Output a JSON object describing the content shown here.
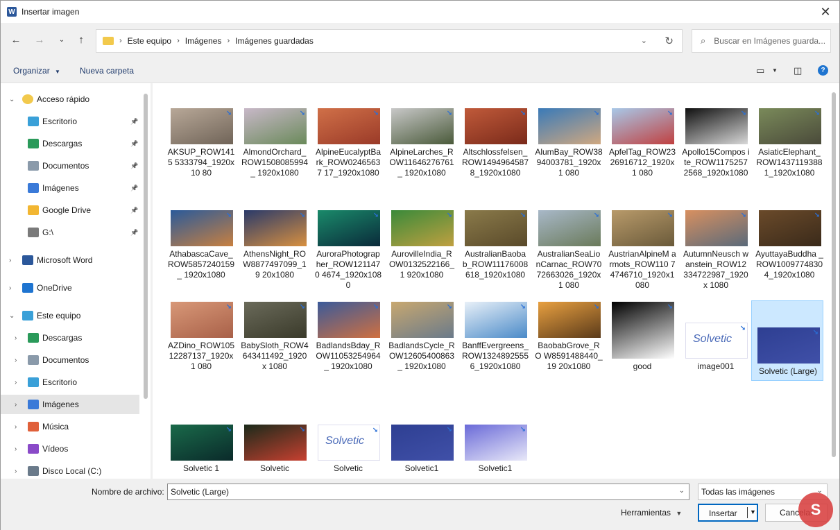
{
  "window": {
    "title": "Insertar imagen"
  },
  "nav": {
    "breadcrumb": [
      "Este equipo",
      "Imágenes",
      "Imágenes guardadas"
    ],
    "search_placeholder": "Buscar en Imágenes guarda..."
  },
  "commands": {
    "organize": "Organizar",
    "new_folder": "Nueva carpeta"
  },
  "sidebar": {
    "items": [
      {
        "label": "Acceso rápido",
        "icon": "star-icon",
        "level": 0,
        "expanded": true
      },
      {
        "label": "Escritorio",
        "icon": "desktop-icon",
        "level": 1,
        "pinned": true
      },
      {
        "label": "Descargas",
        "icon": "download-icon",
        "level": 1,
        "pinned": true
      },
      {
        "label": "Documentos",
        "icon": "document-icon",
        "level": 1,
        "pinned": true
      },
      {
        "label": "Imágenes",
        "icon": "pictures-icon",
        "level": 1,
        "pinned": true
      },
      {
        "label": "Google Drive",
        "icon": "google-drive-icon",
        "level": 1,
        "pinned": true
      },
      {
        "label": "G:\\",
        "icon": "drive-icon",
        "level": 1,
        "pinned": true
      },
      {
        "label": "Microsoft Word",
        "icon": "word-icon",
        "level": 0
      },
      {
        "label": "OneDrive",
        "icon": "cloud-icon",
        "level": 0
      },
      {
        "label": "Este equipo",
        "icon": "computer-icon",
        "level": 0,
        "expanded": true
      },
      {
        "label": "Descargas",
        "icon": "download-icon",
        "level": 1
      },
      {
        "label": "Documentos",
        "icon": "document-icon",
        "level": 1
      },
      {
        "label": "Escritorio",
        "icon": "desktop-icon",
        "level": 1
      },
      {
        "label": "Imágenes",
        "icon": "pictures-icon",
        "level": 1,
        "selected": true
      },
      {
        "label": "Música",
        "icon": "music-icon",
        "level": 1
      },
      {
        "label": "Vídeos",
        "icon": "video-icon",
        "level": 1
      },
      {
        "label": "Disco Local (C:)",
        "icon": "disk-icon",
        "level": 1
      }
    ]
  },
  "files": [
    {
      "name": "AKSUP_ROW1415 5333794_1920x10 80",
      "colors": [
        "#b8a898",
        "#706458"
      ]
    },
    {
      "name": "AlmondOrchard_ ROW1508085994_ 1920x1080",
      "colors": [
        "#c8b8c8",
        "#6a8a5a"
      ]
    },
    {
      "name": "AlpineEucalyptBa rk_ROW02465637 17_1920x1080",
      "colors": [
        "#d07048",
        "#9a3a28"
      ]
    },
    {
      "name": "AlpineLarches_R OW11646276761_ 1920x1080",
      "colors": [
        "#c8c8c8",
        "#4a5a3a"
      ]
    },
    {
      "name": "Altschlossfelsen_ ROW1494964587 8_1920x1080",
      "colors": [
        "#c05a3a",
        "#7a2a1a"
      ]
    },
    {
      "name": "AlumBay_ROW38 94003781_1920x1 080",
      "colors": [
        "#3a7ab8",
        "#d0a880"
      ]
    },
    {
      "name": "ApfelTag_ROW23 26916712_1920x1 080",
      "colors": [
        "#a8c8e8",
        "#c04040"
      ]
    },
    {
      "name": "Apollo15Compos ite_ROW1175257 2568_1920x1080",
      "colors": [
        "#101010",
        "#d8d8d8"
      ]
    },
    {
      "name": "AsiaticElephant_ ROW1437119388 1_1920x1080",
      "colors": [
        "#7a8a5a",
        "#4a4a3a"
      ]
    },
    {
      "name": "AthabascaCave_ ROW5857240159_ 1920x1080",
      "colors": [
        "#2a5a9a",
        "#c88040"
      ]
    },
    {
      "name": "AthensNight_RO W8877497099_19 20x1080",
      "colors": [
        "#2a3a6a",
        "#d89040"
      ]
    },
    {
      "name": "AuroraPhotograp her_ROW1211470 4674_1920x1080",
      "colors": [
        "#1a8a6a",
        "#0a2a3a"
      ]
    },
    {
      "name": "AurovilleIndia_R OW0132522166_1 920x1080",
      "colors": [
        "#3a8a3a",
        "#c0a040"
      ]
    },
    {
      "name": "AustralianBaoba b_ROW11176008 618_1920x1080",
      "colors": [
        "#8a7a4a",
        "#5a4a2a"
      ]
    },
    {
      "name": "AustralianSeaLio nCarnac_ROW70 72663026_1920x1 080",
      "colors": [
        "#a8b8c8",
        "#6a7a5a"
      ]
    },
    {
      "name": "AustrianAlpineM armots_ROW110 74746710_1920x1 080",
      "colors": [
        "#b89a6a",
        "#6a5a3a"
      ]
    },
    {
      "name": "AutumnNeusch wanstein_ROW12 334722987_1920x 1080",
      "colors": [
        "#d89060",
        "#5a6a7a"
      ]
    },
    {
      "name": "AyuttayaBuddha _ROW1009774830 4_1920x1080",
      "colors": [
        "#6a4a2a",
        "#3a2a1a"
      ]
    },
    {
      "name": "AZDino_ROW105 12287137_1920x1 080",
      "colors": [
        "#d89878",
        "#a86048"
      ]
    },
    {
      "name": "BabySloth_ROW4 643411492_1920x 1080",
      "colors": [
        "#6a6a5a",
        "#3a3a2a"
      ]
    },
    {
      "name": "BadlandsBday_R OW11053254964_ 1920x1080",
      "colors": [
        "#3a5a9a",
        "#d07040"
      ]
    },
    {
      "name": "BadlandsCycle_R OW12605400863_ 1920x1080",
      "colors": [
        "#c8a870",
        "#6a7a8a"
      ]
    },
    {
      "name": "BanffEvergreens_ ROW1324892555 6_1920x1080",
      "colors": [
        "#e8f0f8",
        "#4a8ac8"
      ]
    },
    {
      "name": "BaobabGrove_RO W8591488440_19 20x1080",
      "colors": [
        "#e8a040",
        "#5a3a1a"
      ]
    },
    {
      "name": "good",
      "colors": [
        "#000000",
        "#ffffff"
      ],
      "tall": true
    },
    {
      "name": "image001",
      "colors": [
        "#ffffff",
        "#4a6ab8"
      ],
      "logo": true
    },
    {
      "name": "Solvetic (Large)",
      "colors": [
        "#2e3f92",
        "#4050a8"
      ],
      "selected": true
    },
    {
      "name": "Solvetic 1",
      "colors": [
        "#1a6a4a",
        "#0a2a2a"
      ]
    },
    {
      "name": "Solvetic",
      "colors": [
        "#1a2a1a",
        "#c84030"
      ]
    },
    {
      "name": "Solvetic",
      "colors": [
        "#ffffff",
        "#4a6ab8"
      ],
      "logo": true
    },
    {
      "name": "Solvetic1",
      "colors": [
        "#2e3f92",
        "#4050a8"
      ]
    },
    {
      "name": "Solvetic1",
      "colors": [
        "#6a6ad8",
        "#e8e8f8"
      ]
    }
  ],
  "footer": {
    "filename_label": "Nombre de archivo:",
    "filename_value": "Solvetic (Large)",
    "filetype": "Todas las imágenes",
    "tools": "Herramientas",
    "insert": "Insertar",
    "cancel": "Cancelar"
  }
}
